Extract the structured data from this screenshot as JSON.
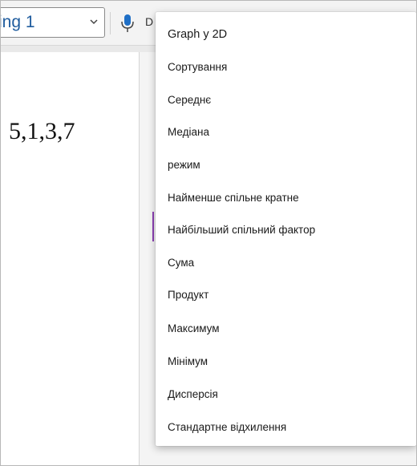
{
  "toolbar": {
    "style_selector_value": "ing 1",
    "dictate_letter": "D"
  },
  "document": {
    "math_text": "5,1,3,7"
  },
  "menu": {
    "items": [
      {
        "label": "Graph у 2D"
      },
      {
        "label": "Сортування"
      },
      {
        "label": "Середнє"
      },
      {
        "label": "Медіана"
      },
      {
        "label": "режим"
      },
      {
        "label": "Найменше спільне кратне"
      },
      {
        "label": "Найбільший спільний фактор"
      },
      {
        "label": "Сума"
      },
      {
        "label": "Продукт"
      },
      {
        "label": "Максимум"
      },
      {
        "label": "Мінімум"
      },
      {
        "label": "Дисперсія"
      },
      {
        "label": "Стандартне відхилення"
      }
    ]
  },
  "colors": {
    "style_text": "#1f5c9e",
    "mic_icon": "#1f6fc6",
    "cursor": "#8b3fb3"
  }
}
